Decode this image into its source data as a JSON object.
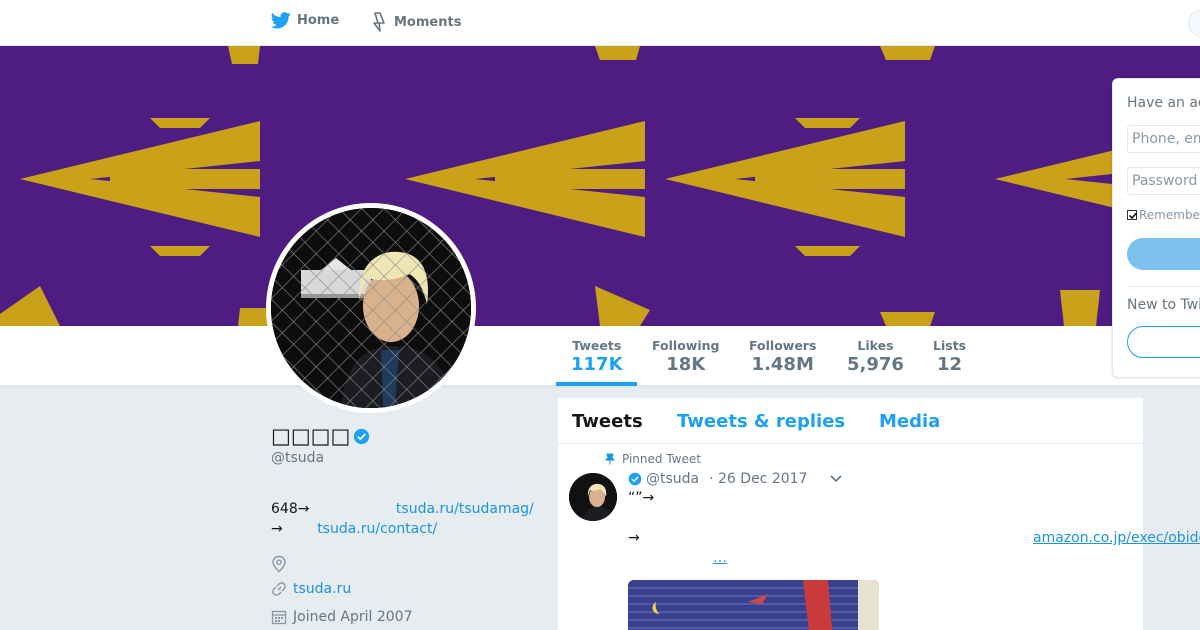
{
  "colors": {
    "accent": "#1da1f2",
    "link": "#1b95e0",
    "banner_bg": "#4f1c82",
    "banner_pattern": "#c9a21a",
    "muted": "#657786"
  },
  "nav": {
    "home_label": "Home",
    "moments_label": "Moments",
    "home_icon": "twitter-bird-icon",
    "moments_icon": "lightning-icon"
  },
  "profile": {
    "name": "□□□□",
    "handle": "@tsuda",
    "bio": {
      "line1_prefix": "648→",
      "line1_link": "tsuda.ru/tsudamag/",
      "line2_prefix": "→",
      "line2_link": "tsuda.ru/contact/"
    },
    "website": "tsuda.ru",
    "joined": "Joined April 2007"
  },
  "stats": [
    {
      "label": "Tweets",
      "value": "117K"
    },
    {
      "label": "Following",
      "value": "18K"
    },
    {
      "label": "Followers",
      "value": "1.48M"
    },
    {
      "label": "Likes",
      "value": "5,976"
    },
    {
      "label": "Lists",
      "value": "12"
    }
  ],
  "timeline": {
    "tabs": [
      "Tweets",
      "Tweets & replies",
      "Media"
    ],
    "pinned_label": "Pinned Tweet",
    "tweet": {
      "handle": "@tsuda",
      "date": "· 26 Dec 2017",
      "line1": "“”→",
      "line2": "→",
      "link": "amazon.co.jp/exec/obidos/ASIN/",
      "ellipsis": "…"
    }
  },
  "login": {
    "title": "Have an account?",
    "phone_placeholder": "Phone, email or username",
    "password_placeholder": "Password",
    "remember_label": "Remember me",
    "new_label": "New to Twitter?"
  }
}
